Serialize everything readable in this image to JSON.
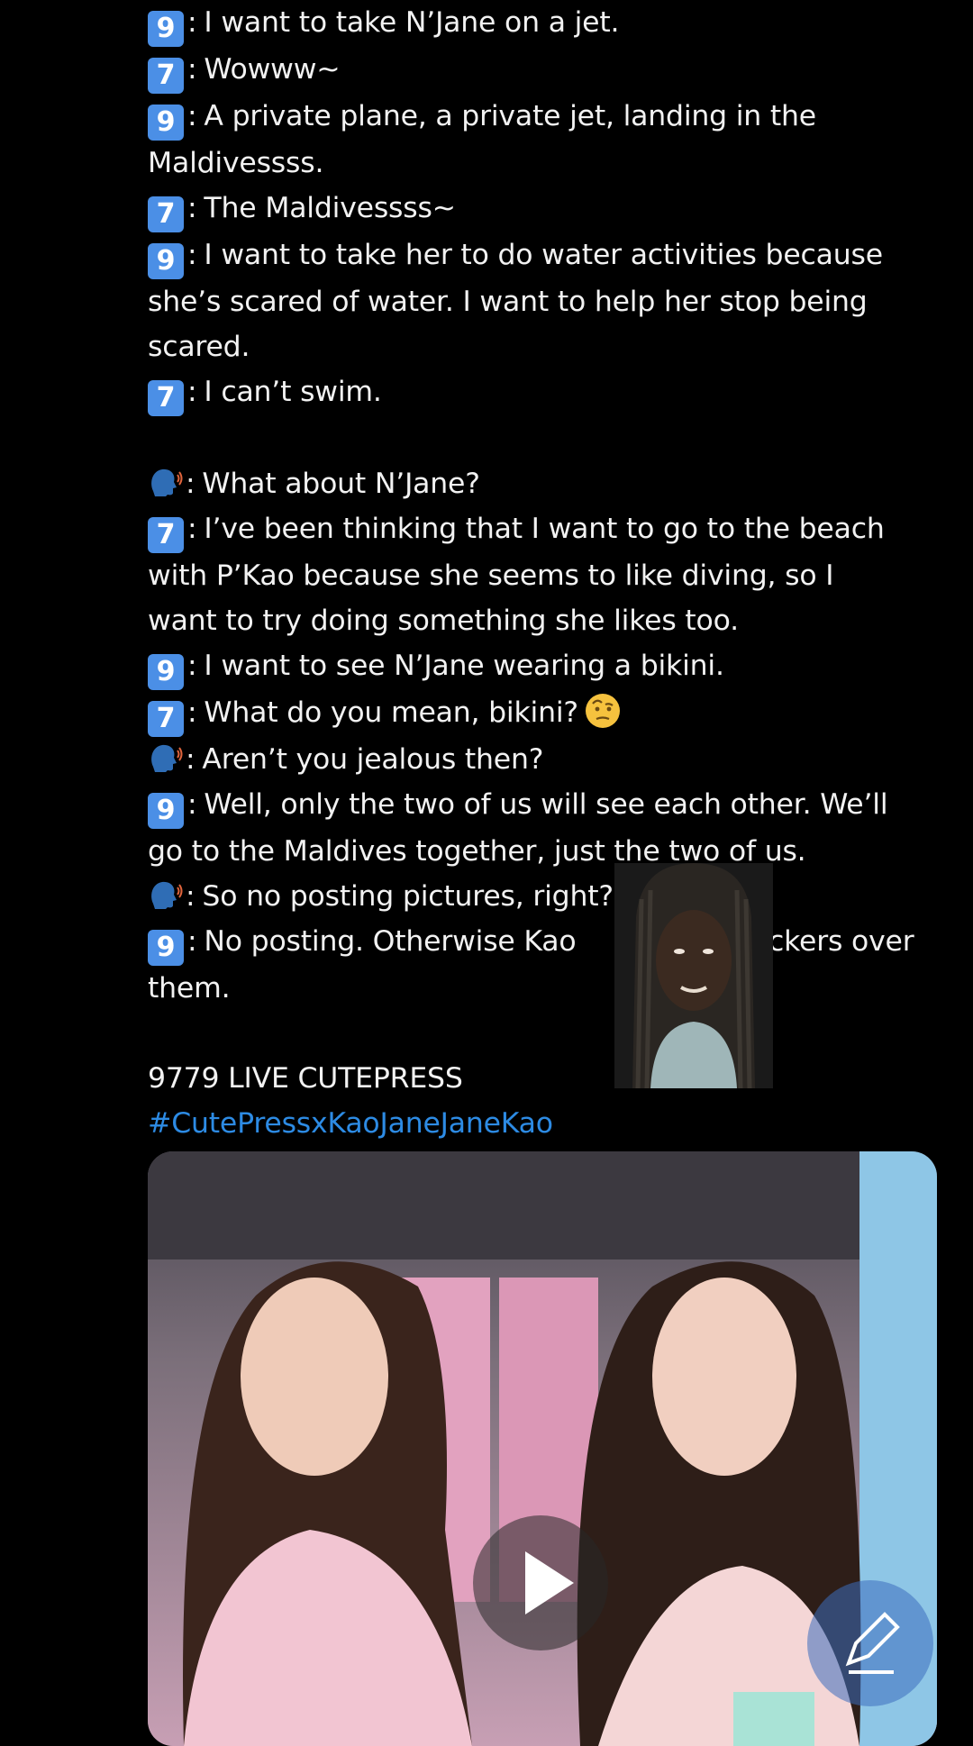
{
  "tweet": {
    "lines": [
      {
        "speaker": "9",
        "text": "I want to take N’Jane on a jet."
      },
      {
        "speaker": "7",
        "text": "Wowww~"
      },
      {
        "speaker": "9",
        "text": "A private plane, a private jet, landing in the"
      },
      {
        "speaker": "",
        "text": "Maldivessss."
      },
      {
        "speaker": "7",
        "text": "The Maldivessss~"
      },
      {
        "speaker": "9",
        "text": "I want to take her to do water activities because"
      },
      {
        "speaker": "",
        "text": "she’s scared of water. I want to help her stop being"
      },
      {
        "speaker": "",
        "text": "scared."
      },
      {
        "speaker": "7",
        "text": "I can’t swim."
      },
      {
        "speaker": "blank",
        "text": ""
      },
      {
        "speaker": "host",
        "text": "What about N’Jane?"
      },
      {
        "speaker": "7",
        "text": "I’ve been thinking that I want to go to the beach"
      },
      {
        "speaker": "",
        "text": "with P’Kao because she seems to like diving, so I"
      },
      {
        "speaker": "",
        "text": "want to try doing something she likes too."
      },
      {
        "speaker": "9",
        "text": "I want to see N’Jane wearing a bikini."
      },
      {
        "speaker": "7",
        "text": "What do you mean, bikini?"
      },
      {
        "speaker": "host",
        "text": "Aren’t you jealous then?"
      },
      {
        "speaker": "9",
        "text": "Well, only the two of us will see each other. We’ll"
      },
      {
        "speaker": "",
        "text": "go to the Maldives together, just the two of us."
      },
      {
        "speaker": "host",
        "text": "So no posting pictures, right?"
      },
      {
        "speaker": "9",
        "text": "No posting. Otherwise Kao                  stickers over"
      },
      {
        "speaker": "",
        "text": "them."
      },
      {
        "speaker": "blank",
        "text": ""
      },
      {
        "speaker": "",
        "text": "9779 LIVE CUTEPRESS"
      }
    ],
    "hashtag": "#CutePressxKaoJaneJaneKao",
    "emoji_after_bikini": "face-with-raised-eyebrow-emoji"
  },
  "media": {
    "play_icon": "play-icon",
    "compose_icon": "compose-icon"
  },
  "overlay": {
    "type": "webcam-overlay"
  }
}
